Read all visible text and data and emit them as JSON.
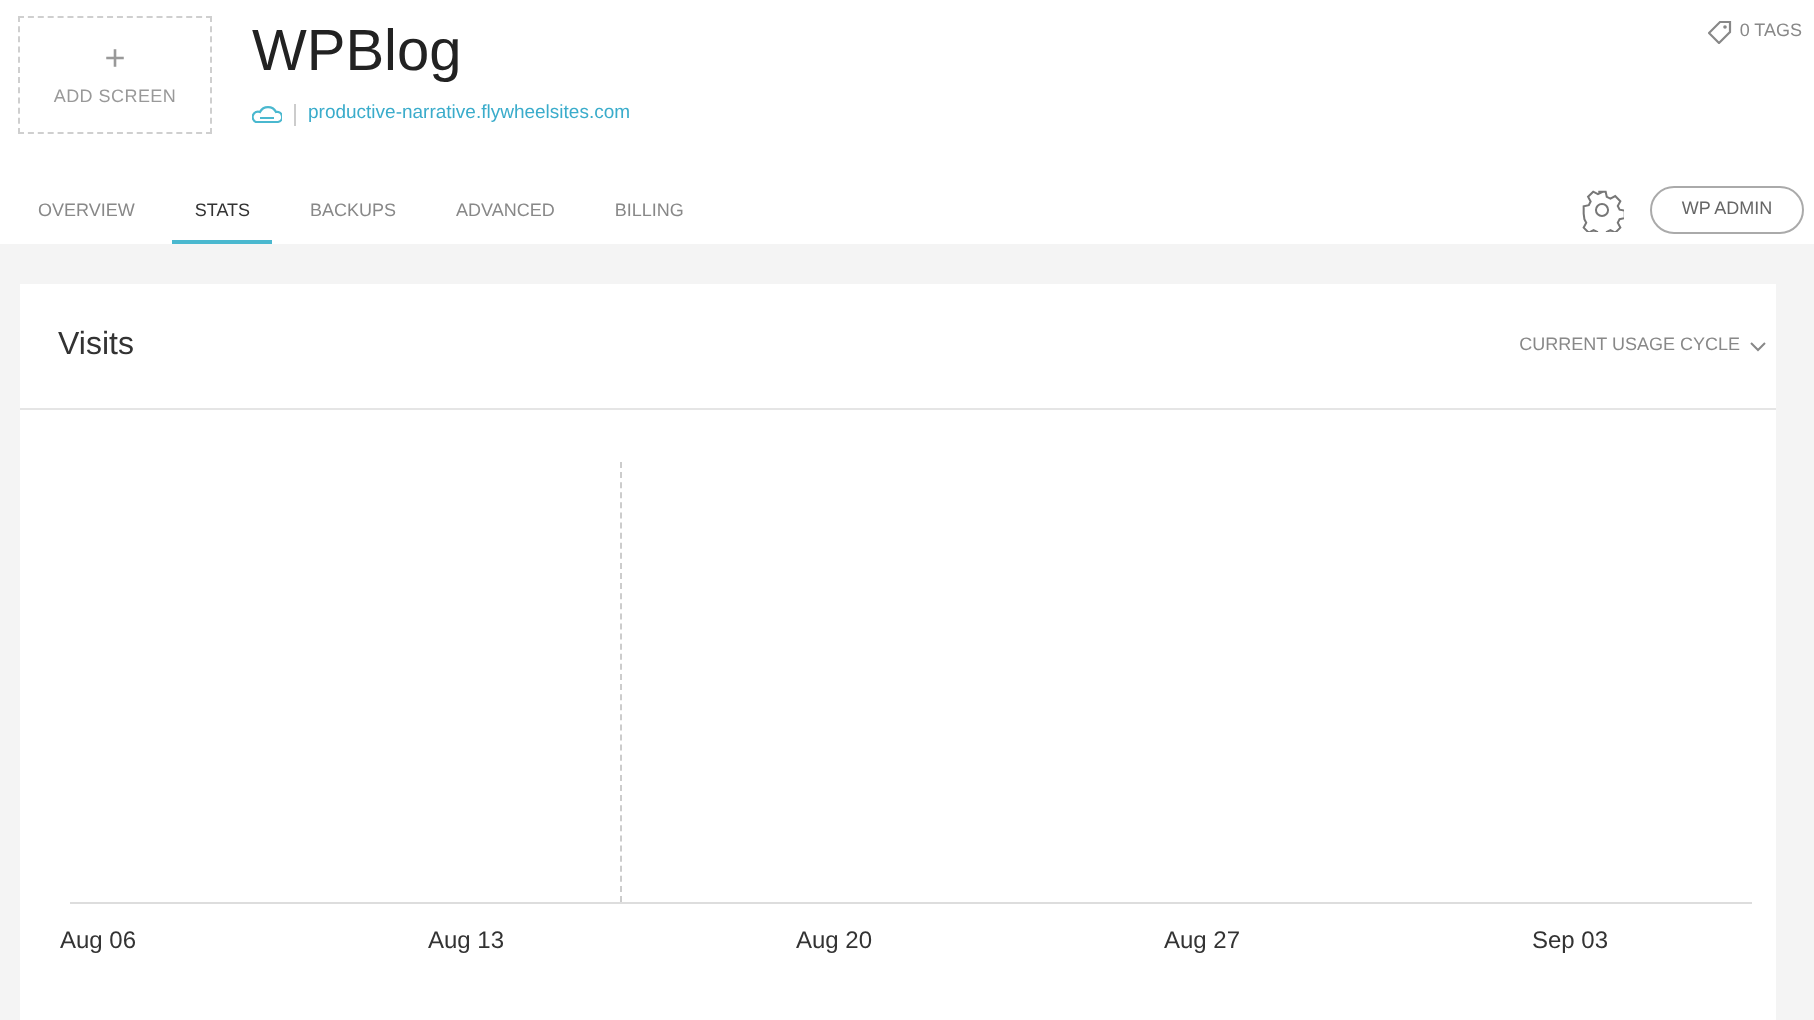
{
  "add_screen": {
    "icon": "+",
    "label": "ADD SCREEN"
  },
  "site": {
    "title": "WPBlog",
    "url": "productive-narrative.flywheelsites.com"
  },
  "tags": {
    "label": "0 TAGS"
  },
  "tabs": [
    {
      "label": "OVERVIEW",
      "selected": false
    },
    {
      "label": "STATS",
      "selected": true
    },
    {
      "label": "BACKUPS",
      "selected": false
    },
    {
      "label": "ADVANCED",
      "selected": false
    },
    {
      "label": "BILLING",
      "selected": false
    }
  ],
  "wp_admin": "WP ADMIN",
  "visits": {
    "title": "Visits",
    "range": "CURRENT USAGE CYCLE",
    "x_labels": [
      "Aug 06",
      "Aug 13",
      "Aug 20",
      "Aug 27",
      "Sep 03"
    ]
  }
}
